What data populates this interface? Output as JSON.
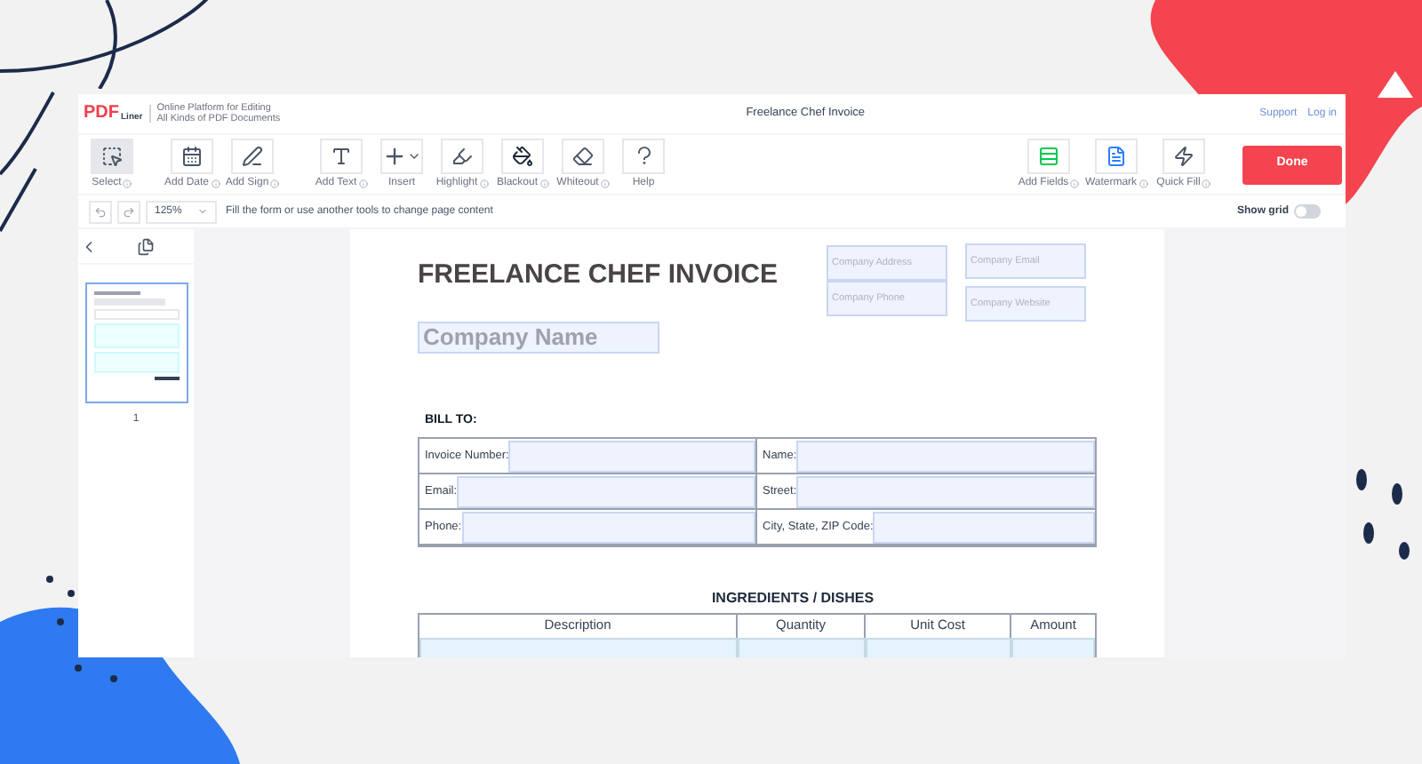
{
  "header": {
    "logo": {
      "main": "PDF",
      "sub": "Liner"
    },
    "tagline": [
      "Online Platform for Editing",
      "All Kinds of PDF Documents"
    ],
    "title": "Freelance Chef Invoice",
    "links": [
      "Support",
      "Log in"
    ]
  },
  "toolbar": {
    "left": [
      {
        "label": "Select",
        "kind": "select",
        "info": true,
        "selected": true
      },
      {
        "label": "Add Date",
        "kind": "date",
        "info": true,
        "selected": false
      },
      {
        "label": "Add Sign",
        "kind": "sign",
        "info": true,
        "selected": false
      },
      {
        "label": "Add Text",
        "kind": "text",
        "info": true,
        "selected": false
      },
      {
        "label": "Insert",
        "kind": "insert",
        "info": false,
        "selected": false
      },
      {
        "label": "Highlight",
        "kind": "highlight",
        "info": true,
        "selected": false
      },
      {
        "label": "Blackout",
        "kind": "blackout",
        "info": true,
        "selected": false
      },
      {
        "label": "Whiteout",
        "kind": "whiteout",
        "info": true,
        "selected": false
      },
      {
        "label": "Help",
        "kind": "help",
        "info": false,
        "selected": false
      }
    ],
    "right": [
      {
        "label": "Add Fields",
        "kind": "fields",
        "info": true,
        "selected": false
      },
      {
        "label": "Watermark",
        "kind": "watermark",
        "info": true,
        "selected": false
      },
      {
        "label": "Quick Fill",
        "kind": "quickfill",
        "info": true,
        "selected": false
      }
    ],
    "done": "Done"
  },
  "subbar": {
    "zoom": "125%",
    "hint": "Fill the form or use another tools to change page content",
    "show_grid": {
      "label": "Show grid",
      "on": false
    }
  },
  "thumbnails": [
    {
      "page": "1",
      "selected": true
    }
  ],
  "document": {
    "title": "FREELANCE CHEF INVOICE",
    "company_name": "Company Name",
    "company_fields": [
      {
        "placeholder": "Company Address"
      },
      {
        "placeholder": "Company Phone"
      },
      {
        "placeholder": "Company Email"
      },
      {
        "placeholder": "Company Website"
      }
    ],
    "bill_to": "BILL TO:",
    "bill_fields": [
      {
        "label": "Invoice Number:"
      },
      {
        "label": "Name:"
      },
      {
        "label": "Email:"
      },
      {
        "label": "Street:"
      },
      {
        "label": "Phone:"
      },
      {
        "label": "City, State, ZIP Code:"
      }
    ],
    "section_title": "INGREDIENTS / DISHES",
    "columns": [
      "Description",
      "Quantity",
      "Unit Cost",
      "Amount"
    ]
  }
}
